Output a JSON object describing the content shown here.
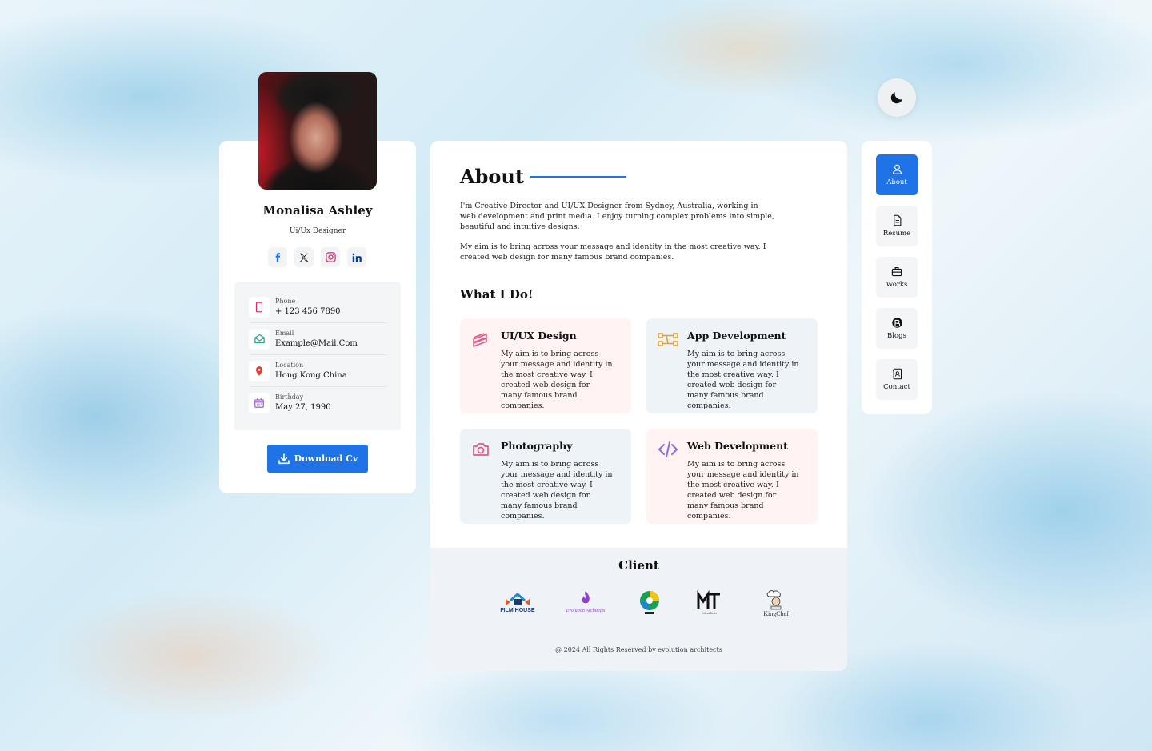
{
  "profile": {
    "name": "Monalisa Ashley",
    "role": "Ui/Ux Designer",
    "socials": [
      "facebook",
      "x",
      "instagram",
      "linkedin"
    ],
    "info": [
      {
        "label": "Phone",
        "value": "+ 123 456 7890",
        "icon": "phone-icon"
      },
      {
        "label": "Email",
        "value": "Example@Mail.Com",
        "icon": "mail-icon"
      },
      {
        "label": "Location",
        "value": "Hong Kong China",
        "icon": "location-icon"
      },
      {
        "label": "Birthday",
        "value": "May 27, 1990",
        "icon": "calendar-icon"
      }
    ],
    "download_label": "Download Cv"
  },
  "about": {
    "title": "About",
    "paragraph1": "I'm Creative Director and UI/UX Designer from Sydney, Australia, working in web development and print media. I enjoy turning complex problems into simple, beautiful and intuitive designs.",
    "paragraph2": "My aim is to bring across your message and identity in the most creative way. I created web design for many famous brand companies.",
    "whatido_title": "What I Do!",
    "services": [
      {
        "title": "UI/UX Design",
        "desc": "My aim is to bring across your message and identity in the most creative way. I created web design for many famous brand companies."
      },
      {
        "title": "App Development",
        "desc": "My aim is to bring across your message and identity in the most creative way. I created web design for many famous brand companies."
      },
      {
        "title": "Photography",
        "desc": "My aim is to bring across your message and identity in the most creative way. I created web design for many famous brand companies."
      },
      {
        "title": "Web Development",
        "desc": "My aim is to bring across your message and identity in the most creative way. I created web design for many famous brand companies."
      }
    ]
  },
  "client": {
    "title": "Client",
    "logos": [
      {
        "name": "film-house-logo",
        "text": "FILM HOUSE"
      },
      {
        "name": "evolution-architects-logo",
        "text": "Evolution Architects"
      },
      {
        "name": "globe-logo",
        "text": ""
      },
      {
        "name": "meet-tech-logo",
        "text": "MeetTech"
      },
      {
        "name": "kingchef-logo",
        "text": "KingChef"
      }
    ],
    "copyright": "@ 2024 All Rights Reserved by evolution architects"
  },
  "nav": {
    "items": [
      {
        "label": "About",
        "icon": "user-icon",
        "active": true
      },
      {
        "label": "Resume",
        "icon": "document-icon",
        "active": false
      },
      {
        "label": "Works",
        "icon": "briefcase-icon",
        "active": false
      },
      {
        "label": "Blogs",
        "icon": "blog-icon",
        "active": false
      },
      {
        "label": "Contact",
        "icon": "contact-book-icon",
        "active": false
      }
    ]
  },
  "colors": {
    "accent": "#1f73e6",
    "pink_card": "#fff4f3",
    "blue_card": "#eef3f8"
  }
}
